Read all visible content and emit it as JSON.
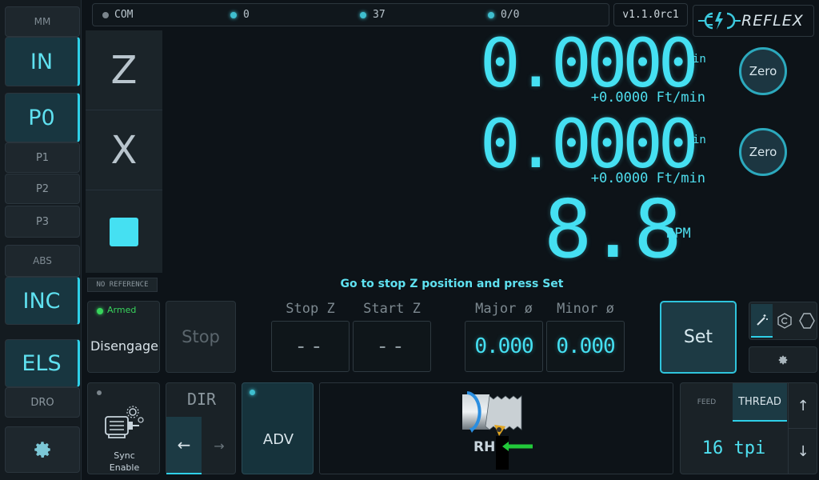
{
  "sidebar": {
    "mm": "MM",
    "in": "IN",
    "p0": "P0",
    "p1": "P1",
    "p2": "P2",
    "p3": "P3",
    "abs": "ABS",
    "inc": "INC",
    "els": "ELS",
    "dro": "DRO",
    "settings_icon": "gear-icon"
  },
  "topbar": {
    "com": "COM",
    "s1": "0",
    "s2": "37",
    "s3": "0/0",
    "version": "v1.1.0rc1",
    "brand": "REFLEX"
  },
  "axes": {
    "z_label": "Z",
    "x_label": "X",
    "z_value": "0.0000",
    "z_unit": "in",
    "z_rate": "+0.0000 Ft/min",
    "x_value": "0.0000",
    "x_unit": "in",
    "x_rate": "+0.0000 Ft/min",
    "zero_label": "Zero",
    "rpm_value": "8.8",
    "rpm_unit": "RPM"
  },
  "status": {
    "reference": "NO REFERENCE",
    "message": "Go to stop Z position and press Set"
  },
  "controls": {
    "armed": "Armed",
    "disengage": "Disengage",
    "stop": "Stop",
    "stop_z_label": "Stop Z",
    "start_z_label": "Start Z",
    "stop_z_value": "--",
    "start_z_value": "--",
    "major_label": "Major ø",
    "minor_label": "Minor ø",
    "major_value": "0.000",
    "minor_value": "0.000",
    "set": "Set"
  },
  "bottom": {
    "sync_line1": "Sync",
    "sync_line2": "Enable",
    "dir": "DIR",
    "dir_left": "←",
    "dir_right": "→",
    "adv": "ADV",
    "hand": "RH",
    "feed_tab": "FEED",
    "thread_tab": "THREAD",
    "pitch": "16 tpi",
    "up": "↑",
    "down": "↓"
  },
  "colors": {
    "accent": "#45e0f2",
    "background": "#0d1318",
    "panel": "#1a2227",
    "led_green": "#38d45c"
  }
}
